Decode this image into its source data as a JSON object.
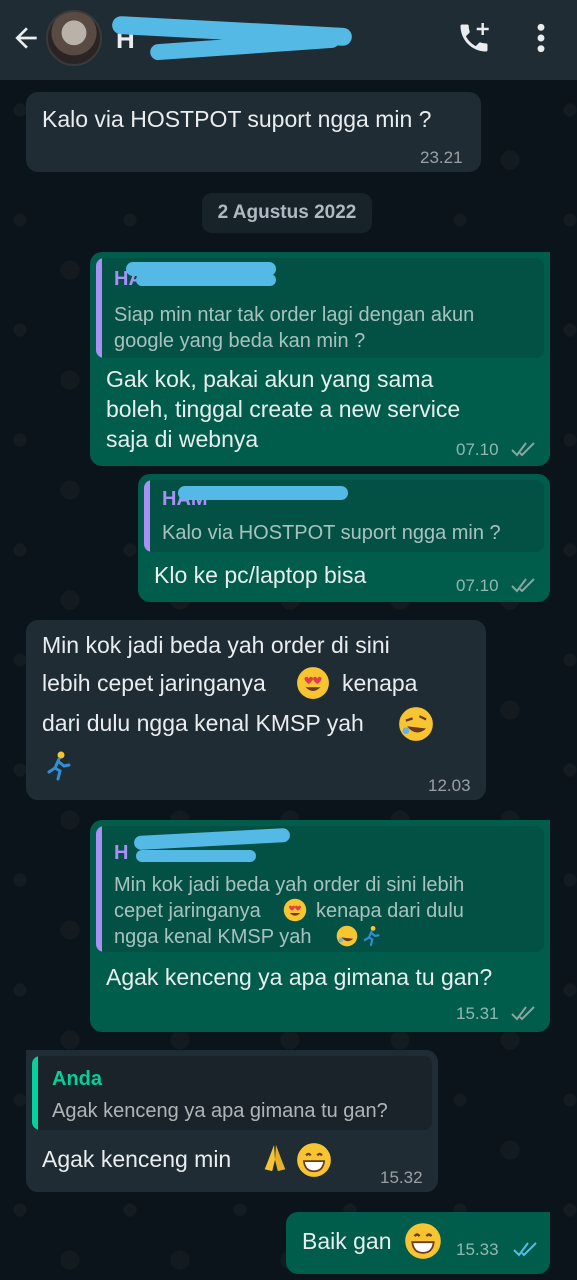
{
  "header": {
    "contact_name": "H",
    "back_icon": "arrow-left-icon",
    "call_icon": "add-call-icon",
    "menu_icon": "more-vert-icon"
  },
  "messages": [
    {
      "dir": "in",
      "text": "Kalo via HOSTPOT suport ngga min ?",
      "time": "23.21"
    },
    {
      "date": "2 Agustus 2022"
    },
    {
      "dir": "out",
      "quote_name": "HAM",
      "quote_text_1": "Siap min ntar tak order lagi dengan akun",
      "quote_text_2": "google yang beda kan min ?",
      "text_1": "Gak kok, pakai akun yang sama",
      "text_2": "boleh, tinggal create a new service",
      "text_3": "saja di webnya",
      "time": "07.10"
    },
    {
      "dir": "out",
      "quote_name": "HAM",
      "quote_text_1": "Kalo via HOSTPOT suport ngga min ?",
      "text_1": "Klo ke pc/laptop bisa",
      "time": "07.10"
    },
    {
      "dir": "in",
      "text_1": "Min kok jadi beda yah order di sini",
      "text_2": "lebih cepet jaringanya",
      "text_2b": "kenapa",
      "text_3": "dari dulu ngga kenal KMSP yah",
      "time": "12.03"
    },
    {
      "dir": "out",
      "quote_name": "H",
      "quote_text_1": "Min kok jadi beda yah order di sini lebih",
      "quote_text_2": "cepet jaringanya",
      "quote_text_2b": "kenapa dari dulu",
      "quote_text_3": "ngga kenal KMSP yah",
      "text_1": "Agak kenceng ya apa gimana tu gan?",
      "time": "15.31"
    },
    {
      "dir": "in",
      "quote_name": "Anda",
      "quote_text_1": "Agak kenceng ya apa gimana tu gan?",
      "text_1": "Agak kenceng min",
      "time": "15.32"
    },
    {
      "dir": "out",
      "text_1": "Baik gan",
      "time": "15.33"
    }
  ],
  "colors": {
    "background": "#0b141a",
    "header": "#1f2c34",
    "incoming": "#202c33",
    "outgoing": "#005c4b",
    "read_ticks": "#53bdeb",
    "quote_purple": "#a791f5",
    "quote_green": "#06cf9c"
  }
}
